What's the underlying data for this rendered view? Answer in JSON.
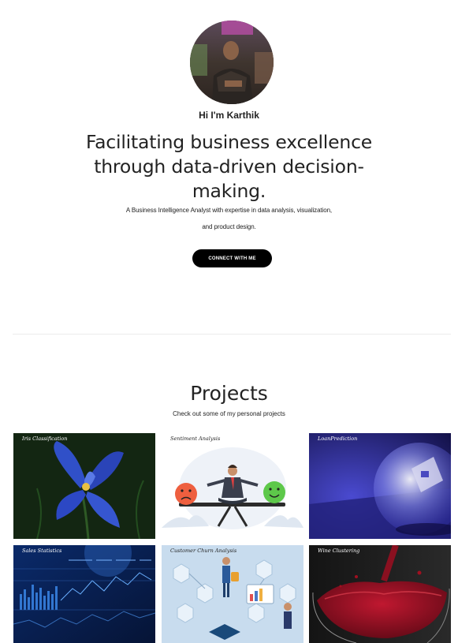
{
  "profile": {
    "greeting": "Hi I'm Karthik",
    "headline": "Facilitating business excellence through data-driven decision-making.",
    "subtitle_line1": "A Business Intelligence Analyst with expertise in data analysis, visualization,",
    "subtitle_line2": "and product design.",
    "cta_label": "CONNECT WITH ME"
  },
  "projects": {
    "title": "Projects",
    "subtitle": "Check out some of my personal projects",
    "cards": [
      {
        "label": "Iris Classification"
      },
      {
        "label": "Sentiment Analysis"
      },
      {
        "label": "LoanPrediction"
      },
      {
        "label": "Sales Statistics"
      },
      {
        "label": "Customer Churn Analysis"
      },
      {
        "label": "Wine Clustering"
      }
    ]
  },
  "colors": {
    "cta_bg": "#000000",
    "text": "#222222",
    "divider": "#ececec"
  }
}
